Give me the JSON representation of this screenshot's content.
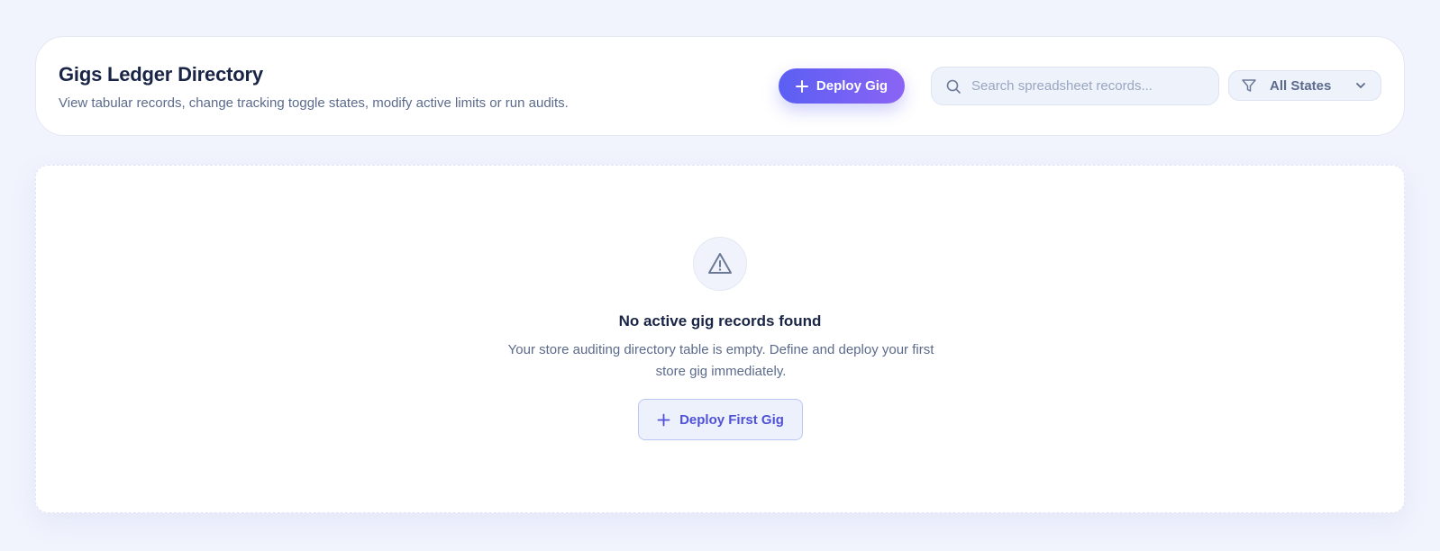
{
  "header": {
    "title": "Gigs Ledger Directory",
    "subtitle": "View tabular records, change tracking toggle states, modify active limits or run audits.",
    "deploy_label": "Deploy Gig",
    "search_placeholder": "Search spreadsheet records...",
    "filter_selected": "All States",
    "icons": [
      "plus-icon",
      "search-icon",
      "filter-icon",
      "chevron-down-icon"
    ]
  },
  "empty_state": {
    "icon": "alert-triangle-icon",
    "title": "No active gig records found",
    "text": "Your store auditing directory table is empty. Define and deploy your first store gig immediately.",
    "button_label": "Deploy First Gig"
  },
  "colors": {
    "background": "#f1f4fd",
    "accent_start": "#5b5ff3",
    "accent_end": "#8b64f4",
    "heading": "#1a2546",
    "muted_text": "#5c6b8c",
    "secondary_button_text": "#4f52d8"
  }
}
